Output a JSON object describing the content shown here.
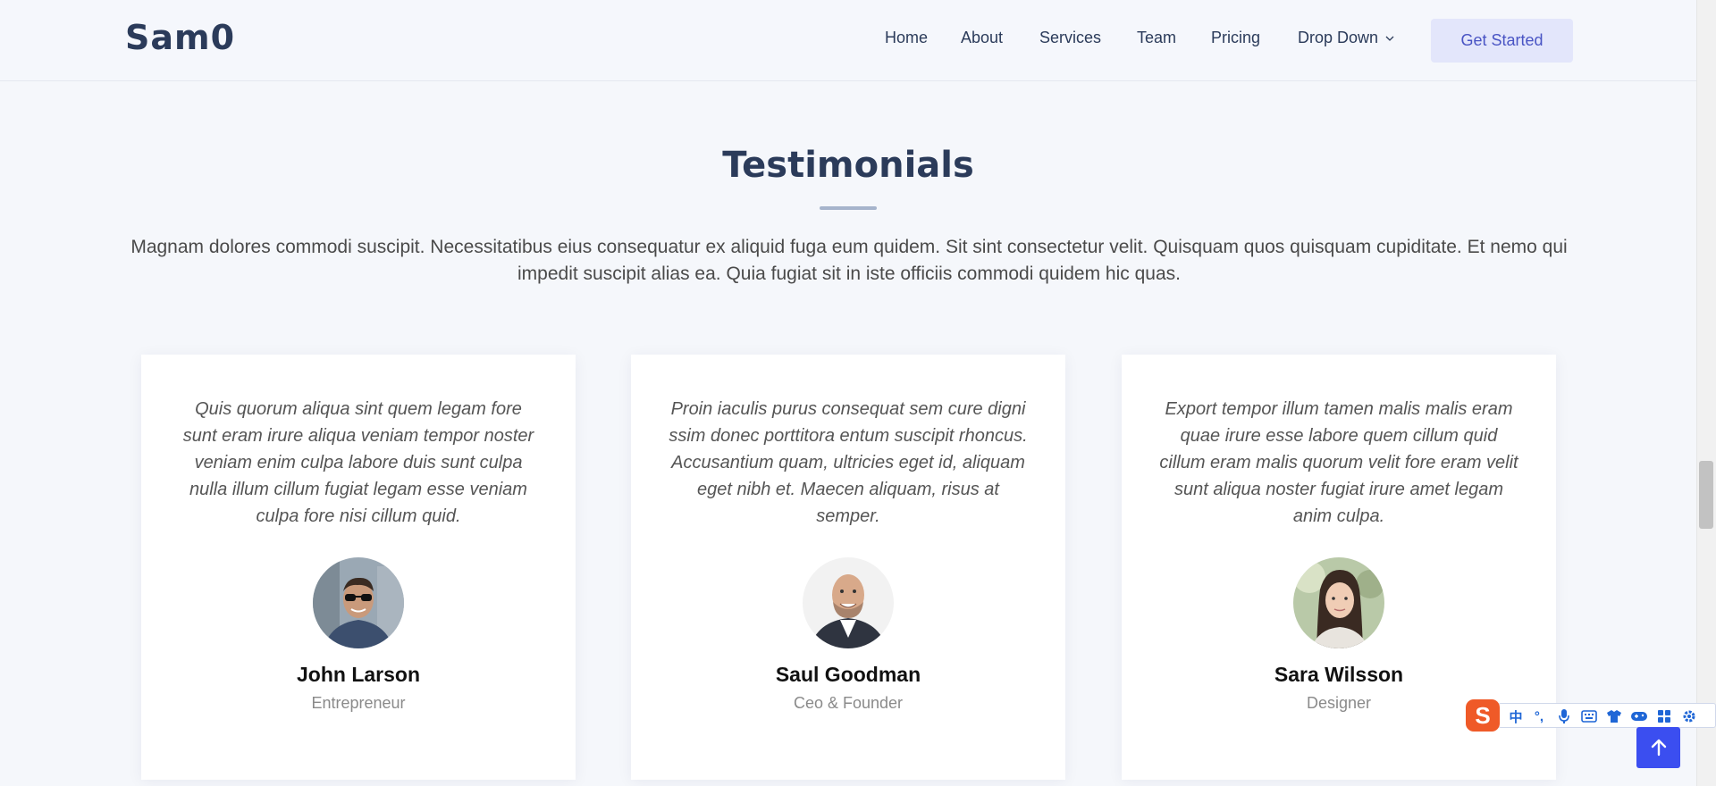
{
  "header": {
    "logo": "Sam0",
    "nav": [
      {
        "label": "Home"
      },
      {
        "label": "About"
      },
      {
        "label": "Services"
      },
      {
        "label": "Team"
      },
      {
        "label": "Pricing"
      },
      {
        "label": "Drop Down",
        "has_dropdown": true
      }
    ],
    "cta_label": "Get Started"
  },
  "testimonials": {
    "title": "Testimonials",
    "lead": "Magnam dolores commodi suscipit. Necessitatibus eius consequatur ex aliquid fuga eum quidem. Sit sint consectetur velit. Quisquam quos quisquam cupiditate. Et nemo qui impedit suscipit alias ea. Quia fugiat sit in iste officiis commodi quidem hic quas.",
    "items": [
      {
        "quote": "Quis quorum aliqua sint quem legam fore sunt eram irure aliqua veniam tempor noster veniam enim culpa labore duis sunt culpa nulla illum cillum fugiat legam esse veniam culpa fore nisi cillum quid.",
        "name": "John Larson",
        "role": "Entrepreneur"
      },
      {
        "quote": "Proin iaculis purus consequat sem cure digni ssim donec porttitora entum suscipit rhoncus. Accusantium quam, ultricies eget id, aliquam eget nibh et. Maecen aliquam, risus at semper.",
        "name": "Saul Goodman",
        "role": "Ceo & Founder"
      },
      {
        "quote": "Export tempor illum tamen malis malis eram quae irure esse labore quem cillum quid cillum eram malis quorum velit fore eram velit sunt aliqua noster fugiat irure amet legam anim culpa.",
        "name": "Sara Wilsson",
        "role": "Designer"
      }
    ]
  },
  "ime": {
    "logo_glyph": "S",
    "items": [
      "中",
      "°,",
      "mic-icon",
      "keyboard-icon",
      "skin-icon",
      "game-icon",
      "apps-icon",
      "settings-icon"
    ]
  },
  "colors": {
    "brand_dark": "#2b3b5a",
    "accent": "#3b4ef0",
    "cta_bg": "#e3e6fb"
  }
}
